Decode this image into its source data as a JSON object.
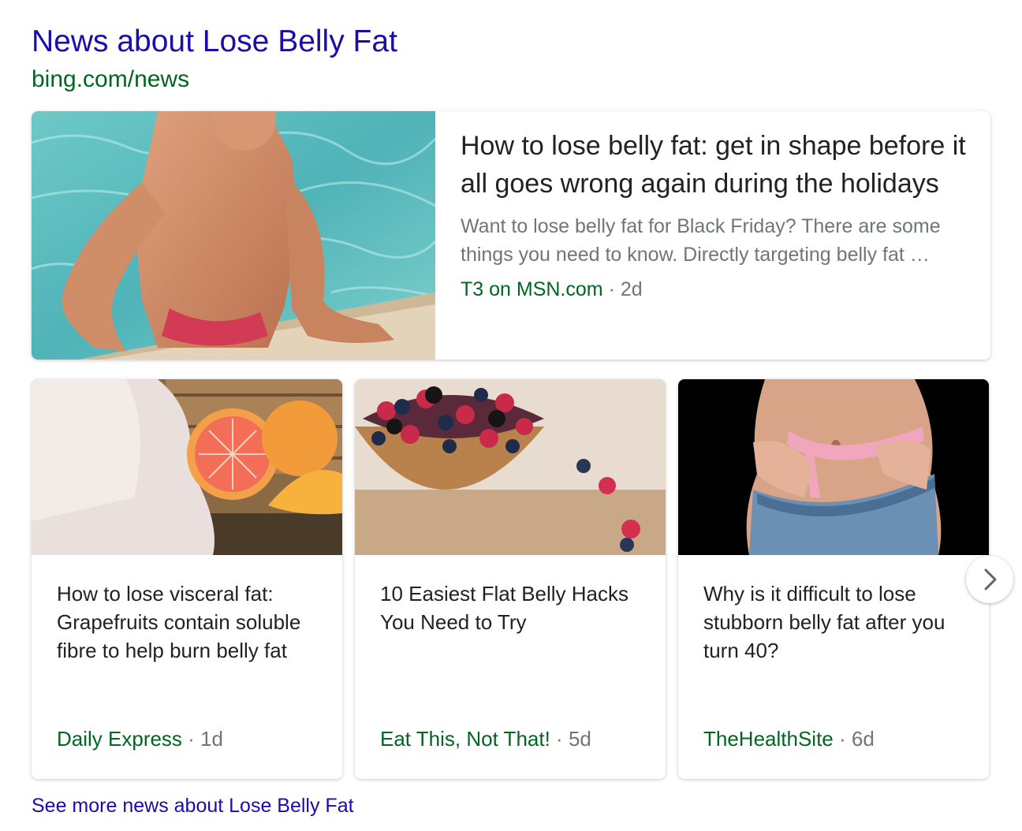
{
  "header": {
    "title": "News about Lose Belly Fat",
    "url": "bing.com/news"
  },
  "featured": {
    "image": "man-in-pool-photo",
    "headline": "How to lose belly fat: get in shape before it all goes wrong again during the holidays",
    "snippet": "Want to lose belly fat for Black Friday? There are some things you need to know. Directly targeting belly fat …",
    "source": "T3 on MSN.com",
    "separator": "·",
    "age": "2d"
  },
  "cards": [
    {
      "image": "grapefruit-photo",
      "headline": "How to lose visceral fat: Grapefruits contain soluble fibre to help burn belly fat",
      "source": "Daily Express",
      "separator": "·",
      "age": "1d"
    },
    {
      "image": "berry-bowl-photo",
      "headline": "10 Easiest Flat Belly Hacks You Need to Try",
      "source": "Eat This, Not That!",
      "separator": "·",
      "age": "5d"
    },
    {
      "image": "measuring-tape-waist-photo",
      "headline": "Why is it difficult to lose stubborn belly fat after you turn 40?",
      "source": "TheHealthSite",
      "separator": "·",
      "age": "6d"
    }
  ],
  "next_button_icon": "chevron-right-icon",
  "see_more": "See more news about Lose Belly Fat",
  "colors": {
    "link_blue": "#1a0dab",
    "url_green": "#006621",
    "meta_gray": "#70757a",
    "headline_dark": "#222222"
  }
}
